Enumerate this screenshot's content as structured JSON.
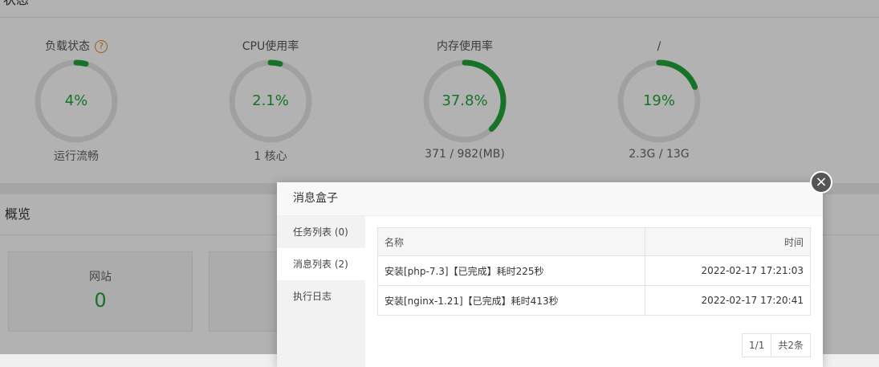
{
  "status": {
    "header": "状态",
    "gauges": [
      {
        "title": "负载状态",
        "value": "4%",
        "percent": 4,
        "sub": "运行流畅",
        "help": "?"
      },
      {
        "title": "CPU使用率",
        "value": "2.1%",
        "percent": 2.1,
        "sub": "1 核心"
      },
      {
        "title": "内存使用率",
        "value": "37.8%",
        "percent": 37.8,
        "sub": "371 / 982(MB)"
      },
      {
        "title": "/",
        "value": "19%",
        "percent": 19,
        "sub": "2.3G / 13G"
      }
    ]
  },
  "overview": {
    "header": "概览",
    "cards": [
      {
        "title": "网站",
        "value": "0"
      }
    ]
  },
  "modal": {
    "title": "消息盒子",
    "close_icon": "×",
    "tabs": [
      {
        "label": "任务列表 (0)",
        "active": false
      },
      {
        "label": "消息列表 (2)",
        "active": true
      },
      {
        "label": "执行日志",
        "active": false
      }
    ],
    "table": {
      "headers": [
        "名称",
        "时间"
      ],
      "rows": [
        {
          "name": "安装[php-7.3]【已完成】耗时225秒",
          "time": "2022-02-17 17:21:03"
        },
        {
          "name": "安装[nginx-1.21]【已完成】耗时413秒",
          "time": "2022-02-17 17:20:41"
        }
      ]
    },
    "pager": {
      "page": "1/1",
      "total": "共2条"
    }
  },
  "colors": {
    "accent": "#20a53a",
    "ring_bg": "#e6e6e6",
    "help": "#e0891e"
  }
}
